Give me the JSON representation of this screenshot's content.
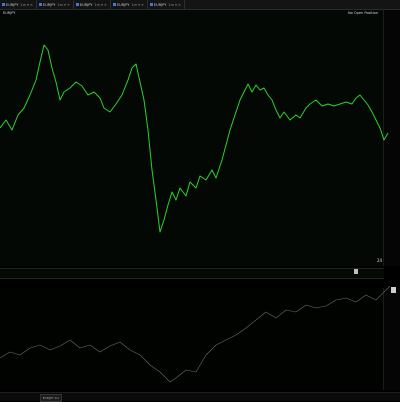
{
  "tabs": [
    {
      "label": "EURJPY",
      "controls": "1m ▾ ✕"
    },
    {
      "label": "EURJPY",
      "controls": "1m ▾ ✕"
    },
    {
      "label": "EURJPY",
      "controls": "1m ▾ ✕"
    },
    {
      "label": "EURJPY",
      "controls": "1m ▾ ✕"
    },
    {
      "label": "EURJPY",
      "controls": "1m ▾ ✕"
    }
  ],
  "price_pane": {
    "title_left": "EURJPY",
    "title_right": "No Open Position",
    "line_color": "#2bd22b",
    "scale_labels": [
      "",
      "",
      "",
      "",
      "",
      "",
      "",
      "",
      "",
      "",
      "",
      "",
      "",
      "",
      "",
      "",
      "",
      "",
      "",
      "",
      ""
    ]
  },
  "indicator_pane": {
    "line_color": "#6a6a6a",
    "scale_labels": [
      "",
      "",
      "",
      "",
      "",
      "",
      "",
      ""
    ]
  },
  "time_axis": {
    "labels": [
      "",
      "",
      "",
      "",
      "",
      "",
      "",
      "",
      "",
      "",
      "",
      "",
      "",
      "",
      "",
      "",
      "",
      "",
      "",
      "",
      "",
      "",
      ""
    ]
  },
  "badge": "24",
  "status_tab": "EURJPY 1m"
}
